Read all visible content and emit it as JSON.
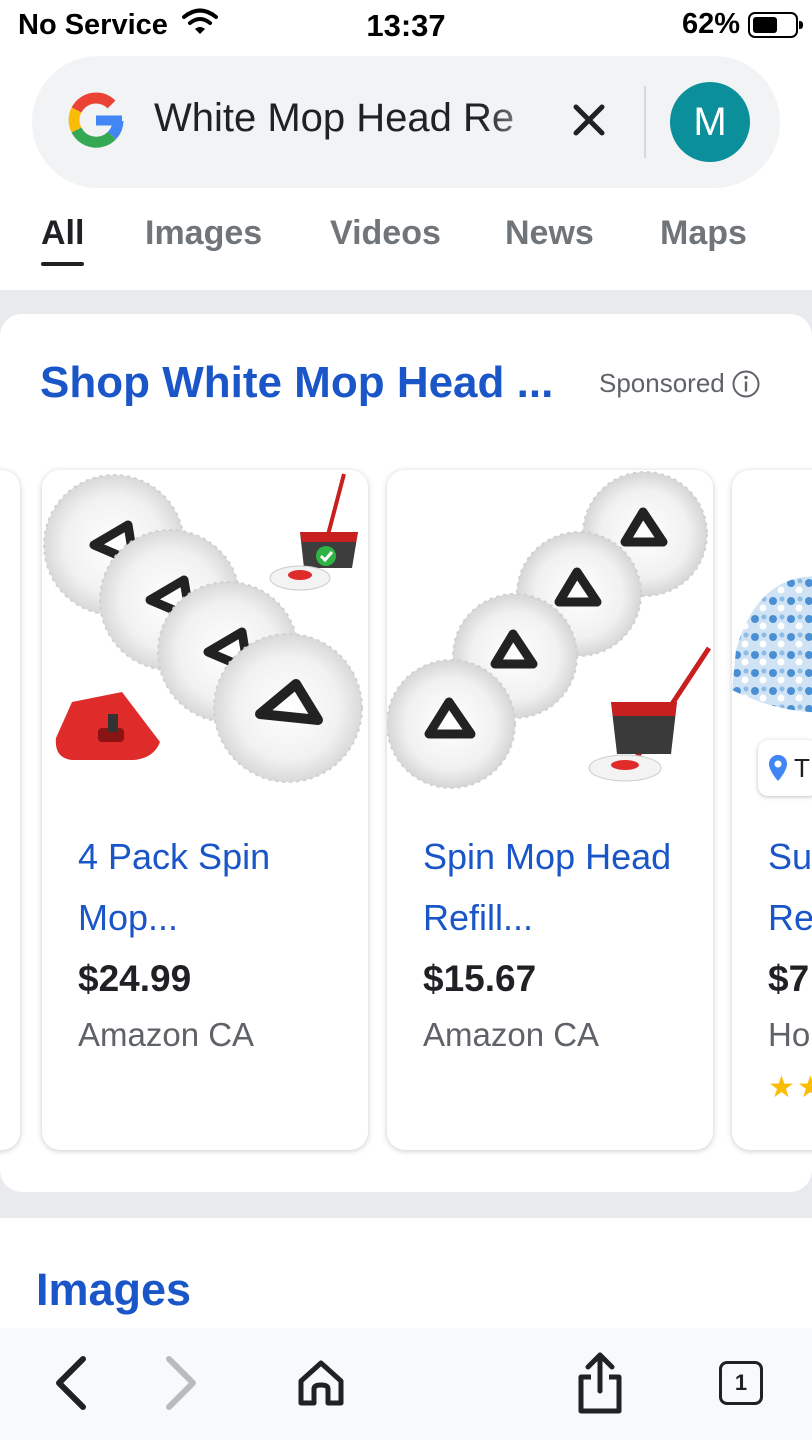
{
  "status_bar": {
    "carrier": "No Service",
    "time": "13:37",
    "battery_percent": "62%",
    "battery_level": 0.62
  },
  "search": {
    "query": "White Mop Head Re",
    "avatar_initial": "M"
  },
  "tabs": [
    {
      "label": "All",
      "active": true
    },
    {
      "label": "Images",
      "active": false
    },
    {
      "label": "Videos",
      "active": false
    },
    {
      "label": "News",
      "active": false
    },
    {
      "label": "Maps",
      "active": false
    }
  ],
  "shopping": {
    "title": "Shop White Mop Head ...",
    "sponsored_label": "Sponsored",
    "products": [
      {
        "title": "4 Pack Spin Mop...",
        "price": "$24.99",
        "store": "Amazon CA"
      },
      {
        "title": "Spin Mop Head Refill...",
        "price": "$15.67",
        "store": "Amazon CA"
      },
      {
        "title_line1": "Su",
        "title_line2": "Re",
        "price": "$7",
        "store": "Ho",
        "pin_label": "T"
      }
    ]
  },
  "images_section": {
    "heading": "Images"
  },
  "toolbar": {
    "tab_count": "1"
  },
  "colors": {
    "link_blue": "#1a56c8",
    "avatar_teal": "#0b8f9b",
    "star_yellow": "#fbbc04",
    "mop_red": "#e02b2b"
  }
}
